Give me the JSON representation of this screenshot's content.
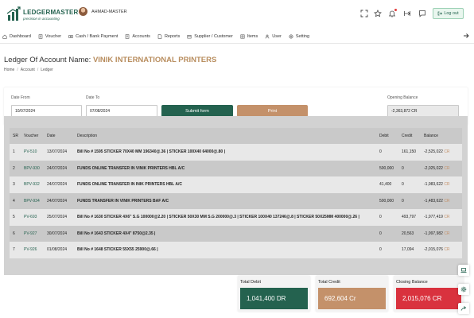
{
  "brand": {
    "name": "LEDGERMASTER",
    "tagline": "precision in accounting"
  },
  "user": {
    "name": "AHMAD-MASTER"
  },
  "header": {
    "logout_label": "Log out"
  },
  "nav": [
    {
      "label": "Dashboard",
      "icon": "home-icon"
    },
    {
      "label": "Voucher",
      "icon": "voucher-icon"
    },
    {
      "label": "Cash / Bank Payment",
      "icon": "cash-icon"
    },
    {
      "label": "Accounts",
      "icon": "accounts-icon"
    },
    {
      "label": "Reports",
      "icon": "reports-icon"
    },
    {
      "label": "Supplier / Customer",
      "icon": "supplier-icon"
    },
    {
      "label": "Items",
      "icon": "items-icon"
    },
    {
      "label": "User",
      "icon": "user-icon"
    },
    {
      "label": "Setting",
      "icon": "settings-icon"
    }
  ],
  "page": {
    "title_prefix": "Ledger Of Account Name:",
    "account_name": "VINIK INTERNATIONAL PRINTERS",
    "breadcrumb": [
      "Home",
      "Account",
      "Ledger"
    ]
  },
  "filters": {
    "date_from_label": "Date From",
    "date_from_value": "10/07/2024",
    "date_to_label": "Date To",
    "date_to_value": "07/08/2024",
    "submit_label": "Submit form",
    "print_label": "Print",
    "opening_balance_label": "Opening Balance",
    "opening_balance_value": "-2,363,872 CR"
  },
  "table": {
    "columns": [
      "SR",
      "Voucher",
      "Date",
      "Description",
      "Debit",
      "Credit",
      "Balance"
    ],
    "rows": [
      {
        "sr": "1",
        "voucher": "PV-510",
        "date": "13/07/2024",
        "description": "Bill No # 1595 STICKER 70X40 MM 196340@.36 | STICKER 100X40 64000@.80 |",
        "debit": "0",
        "credit": "161,150",
        "balance": "-2,525,022",
        "balance_suffix": "CR"
      },
      {
        "sr": "2",
        "voucher": "BPV-930",
        "date": "24/07/2024",
        "description": "FUNDS ONLINE TRANSFER IN VINIK PRINTERS HBL A/C",
        "debit": "500,000",
        "credit": "0",
        "balance": "-2,025,022",
        "balance_suffix": "CR"
      },
      {
        "sr": "3",
        "voucher": "BPV-932",
        "date": "24/07/2024",
        "description": "FUNDS ONLINE TRANSFER IN INIK PRINTERS HBL A/C",
        "debit": "41,400",
        "credit": "0",
        "balance": "-1,983,622",
        "balance_suffix": "CR"
      },
      {
        "sr": "4",
        "voucher": "BPV-934",
        "date": "24/07/2024",
        "description": "FUNDS TRANSFER IN VINIK PRINTERS BAF A/C",
        "debit": "500,000",
        "credit": "0",
        "balance": "-1,483,622",
        "balance_suffix": "CR"
      },
      {
        "sr": "5",
        "voucher": "PV-693",
        "date": "25/07/2024",
        "description": "Bill No # 1630 STICKER 4X6\" S.G 100000@2.20 | STICKER 50X30 MM S.G 200000@.3 | STICKER 100X40 137246@.8 | STICKER 50X25MM 400000@.26 |",
        "debit": "0",
        "credit": "493,797",
        "balance": "-1,977,419",
        "balance_suffix": "CR"
      },
      {
        "sr": "6",
        "voucher": "PV-927",
        "date": "30/07/2024",
        "description": "Bill No # 1643 STICKER 4X4\" 8750@2.35 |",
        "debit": "0",
        "credit": "20,563",
        "balance": "-1,997,982",
        "balance_suffix": "CR"
      },
      {
        "sr": "7",
        "voucher": "PV-926",
        "date": "01/08/2024",
        "description": "Bill No # 1648 STICKER 55X55 25900@.66 |",
        "debit": "0",
        "credit": "17,094",
        "balance": "-2,015,076",
        "balance_suffix": "CR"
      }
    ]
  },
  "totals": {
    "debit_label": "Total Debit",
    "debit_value": "1,041,400 DR",
    "credit_label": "Total Credit",
    "credit_value": "692,604 Cr",
    "closing_label": "Closing Balance",
    "closing_value": "2,015,076 CR"
  },
  "colors": {
    "brand_green": "#24624f",
    "accent_tan": "#c4916a",
    "closing_red": "#d9323e"
  }
}
